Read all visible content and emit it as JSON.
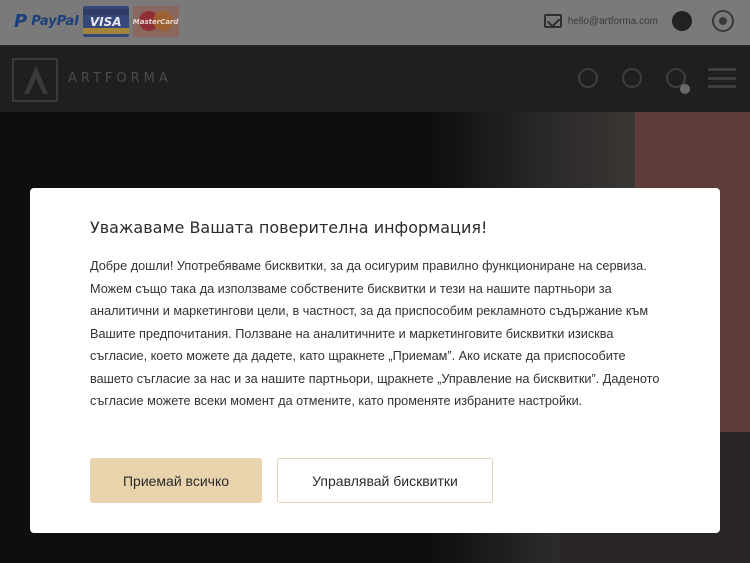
{
  "topbar": {
    "paypal_mark": "P",
    "paypal_label": "PayPal",
    "visa_label": "VISA",
    "mastercard_label": "MasterCard",
    "email": "hello@artforma.com",
    "icons": [
      "paypal-logo",
      "visa-logo",
      "mastercard-logo",
      "mail-icon",
      "language-icon",
      "whatsapp-icon"
    ]
  },
  "navbar": {
    "brand": "ARTFORMA",
    "icons": [
      "user-icon",
      "heart-icon",
      "cart-icon",
      "menu-icon"
    ]
  },
  "cookie_modal": {
    "title": "Уважаваме Вашата поверителна информация!",
    "body": "Добре дошли! Употребяваме бисквитки, за да осигурим правилно функциониране на сервиза. Можем също така да използваме собствените бисквитки и тези на нашите партньори за аналитични и маркетингови цели, в частност, за да приспособим рекламното съдържание към Вашите предпочитания. Ползване на аналитичните и маркетинговите бисквитки изисква съгласие, което можете да дадете, като щракнете „Приемам”. Ако искате да приспособите вашето съгласие за нас и за нашите партньори, щракнете „Управление на бисквитки”. Даденото съгласие можете всеки момент да отмените, като променяте избраните настройки.",
    "accept_label": "Приемай всичко",
    "manage_label": "Управлявай бисквитки"
  },
  "colors": {
    "accept_button": "#e8d3ad",
    "manage_border": "#e2d2b5",
    "overlay_topbar": "#7a7a7a",
    "navbar": "#1f1f1f"
  }
}
